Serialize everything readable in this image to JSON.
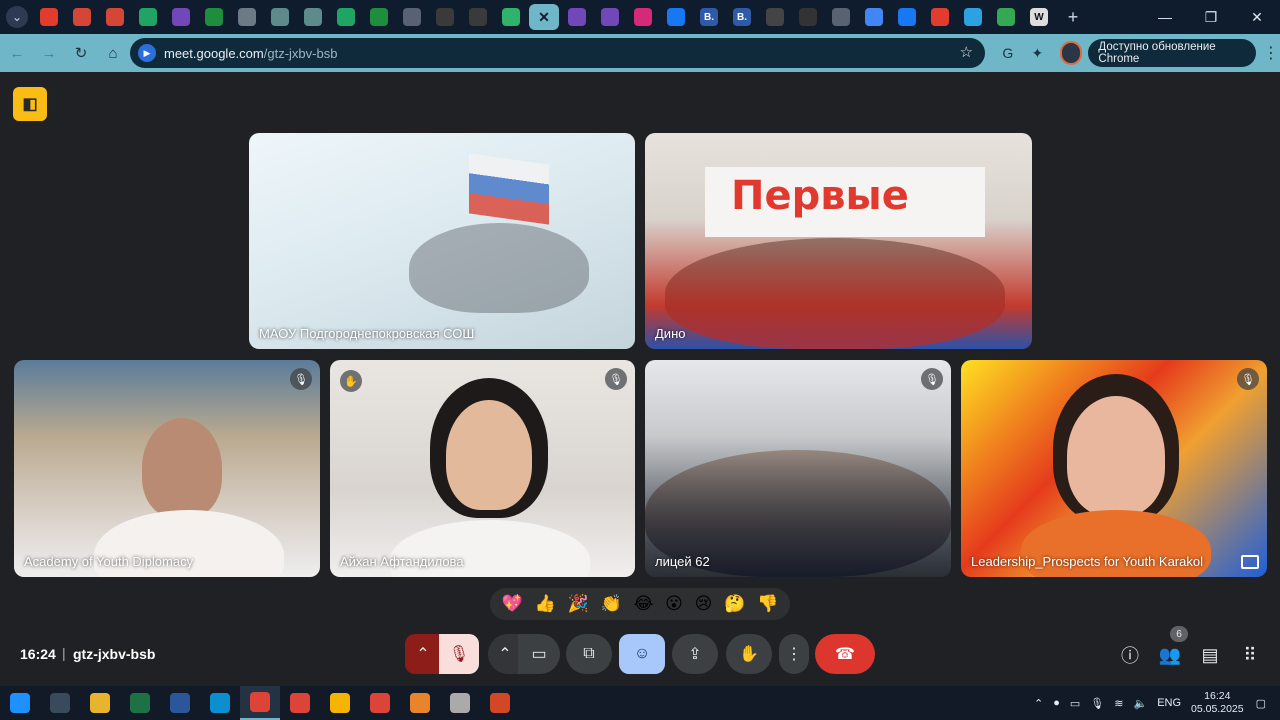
{
  "browser": {
    "tabs": [
      {
        "name": "youtube",
        "color": "#e33b2e"
      },
      {
        "name": "gmail",
        "color": "#d44638"
      },
      {
        "name": "gmail",
        "color": "#d44638"
      },
      {
        "name": "drive",
        "color": "#1fa463"
      },
      {
        "name": "forms",
        "color": "#7248b9"
      },
      {
        "name": "sheets",
        "color": "#1e8e3e"
      },
      {
        "name": "chatgpt",
        "color": "#6b7a85"
      },
      {
        "name": "chatgpt",
        "color": "#5d8a8a"
      },
      {
        "name": "chatgpt",
        "color": "#5d8a8a"
      },
      {
        "name": "drive",
        "color": "#1fa463"
      },
      {
        "name": "sheets-plus",
        "color": "#1e8e3e"
      },
      {
        "name": "globe",
        "color": "#596273"
      },
      {
        "name": "openai",
        "color": "#3a3a3a"
      },
      {
        "name": "openai",
        "color": "#3a3a3a"
      },
      {
        "name": "sb",
        "color": "#2fb36a"
      },
      {
        "name": "meet-active",
        "color": "#6fb6c8"
      },
      {
        "name": "forms",
        "color": "#7248b9"
      },
      {
        "name": "forms",
        "color": "#7248b9"
      },
      {
        "name": "instagram",
        "color": "#d6297b"
      },
      {
        "name": "meta",
        "color": "#1877f2"
      },
      {
        "name": "b-site",
        "color": "#2e5aa8"
      },
      {
        "name": "b-site",
        "color": "#2e5aa8"
      },
      {
        "name": "kids",
        "color": "#444"
      },
      {
        "name": "book",
        "color": "#333"
      },
      {
        "name": "globe",
        "color": "#596273"
      },
      {
        "name": "google",
        "color": "#4285f4"
      },
      {
        "name": "facebook",
        "color": "#1877f2"
      },
      {
        "name": "youtube",
        "color": "#e33b2e"
      },
      {
        "name": "telegram",
        "color": "#2aa3e0"
      },
      {
        "name": "maps",
        "color": "#34a853"
      },
      {
        "name": "wikipedia",
        "color": "#ddd"
      }
    ],
    "tab_wiki_letter": "W",
    "tab_b_letter": "B.",
    "active_tab_close": "✕",
    "url_host": "meet.google.com",
    "url_path": "/gtz-jxbv-bsb",
    "update_label": "Доступно обновление Chrome"
  },
  "meet": {
    "tiles": [
      {
        "name": "МАОУ Подгороднепокровская СОШ"
      },
      {
        "name": "Дино",
        "banner": "Первые"
      },
      {
        "name": "Academy of Youth Diplomacy",
        "muted": true
      },
      {
        "name": "Айхан Афтандилова",
        "muted": true,
        "hand": true
      },
      {
        "name": "лицей 62",
        "muted": true
      },
      {
        "name": "Leadership_Prospects for Youth Karakol",
        "muted": true
      }
    ],
    "reactions": [
      "💖",
      "👍",
      "🎉",
      "👏",
      "😂",
      "😮",
      "😢",
      "🤔",
      "👎"
    ],
    "time": "16:24",
    "meeting_code": "gtz-jxbv-bsb",
    "participant_count": "6"
  },
  "taskbar": {
    "apps": [
      {
        "name": "start",
        "color": "#1e90ff"
      },
      {
        "name": "task-view",
        "color": "#394a5c"
      },
      {
        "name": "file-explorer",
        "color": "#e8b32e"
      },
      {
        "name": "excel",
        "color": "#1e7145"
      },
      {
        "name": "word",
        "color": "#2b579a"
      },
      {
        "name": "edge",
        "color": "#0c8fcf"
      },
      {
        "name": "chrome",
        "color": "#db4437"
      },
      {
        "name": "chrome",
        "color": "#db4437"
      },
      {
        "name": "chrome-alt",
        "color": "#f4b400"
      },
      {
        "name": "chrome",
        "color": "#db4437"
      },
      {
        "name": "app-orange",
        "color": "#e8842c"
      },
      {
        "name": "printer",
        "color": "#aaa"
      },
      {
        "name": "powerpoint",
        "color": "#d24726"
      }
    ],
    "lang": "ENG",
    "time": "16:24",
    "date": "05.05.2025"
  }
}
